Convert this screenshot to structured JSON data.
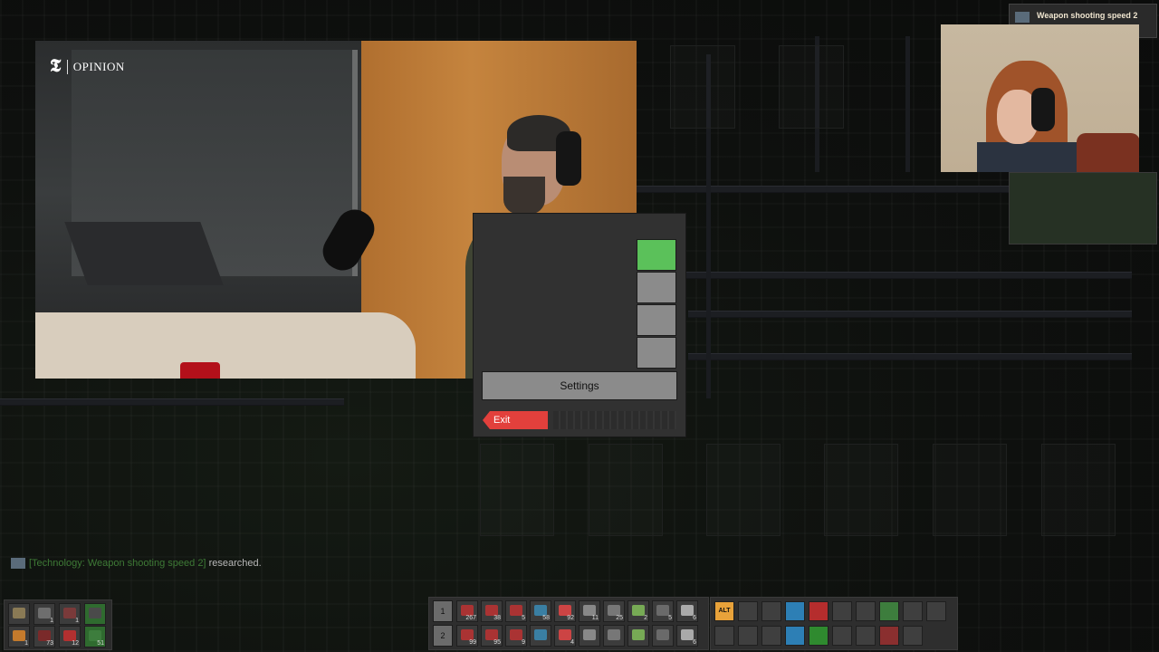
{
  "video_overlay": {
    "brand_mark": "𝕿",
    "brand_label": "OPINION"
  },
  "research_notification": {
    "title": "Weapon shooting speed 2",
    "icon": "technology-icon"
  },
  "game_menu": {
    "settings_label": "Settings",
    "exit_label": "Exit",
    "colors": {
      "primary": "#5bc15a",
      "danger": "#e2403c",
      "button": "#8b8b8b"
    }
  },
  "chat": {
    "technology": "[Technology: Weapon shooting speed 2]",
    "suffix": "researched."
  },
  "quickbar_left": {
    "row1": [
      "",
      "1",
      "1",
      ""
    ],
    "row2": [
      "1",
      "73",
      "12",
      "51"
    ]
  },
  "quickbar": {
    "row_numbers": [
      "1",
      "2"
    ],
    "row1_counts": [
      "267",
      "38",
      "5",
      "58",
      "92",
      "11",
      "25",
      "2",
      "5",
      "6"
    ],
    "row2_counts": [
      "99",
      "95",
      "9",
      "",
      "4",
      "",
      "",
      "",
      "",
      "6"
    ]
  },
  "toolbar": {
    "alt_label": "ALT"
  }
}
